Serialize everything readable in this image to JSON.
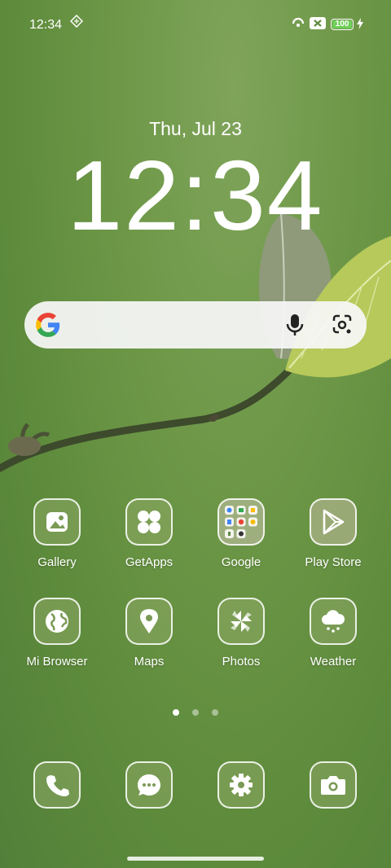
{
  "status_bar": {
    "time": "12:34",
    "battery": "100",
    "icons": [
      "vpn-diamond-icon",
      "hotspot-icon",
      "sim-x-icon",
      "charging-bolt-icon"
    ]
  },
  "clock": {
    "date": "Thu, Jul 23",
    "time": "12:34"
  },
  "search": {
    "icons": [
      "google-g-icon",
      "mic-icon",
      "lens-icon"
    ]
  },
  "apps": [
    {
      "label": "Gallery",
      "icon": "gallery-icon"
    },
    {
      "label": "GetApps",
      "icon": "getapps-icon"
    },
    {
      "label": "Google",
      "icon": "google-folder-icon"
    },
    {
      "label": "Play Store",
      "icon": "play-store-icon"
    },
    {
      "label": "Mi Browser",
      "icon": "globe-icon"
    },
    {
      "label": "Maps",
      "icon": "maps-pin-icon"
    },
    {
      "label": "Photos",
      "icon": "pinwheel-icon"
    },
    {
      "label": "Weather",
      "icon": "cloud-snow-icon"
    }
  ],
  "dock": [
    {
      "icon": "phone-icon"
    },
    {
      "icon": "messages-icon"
    },
    {
      "icon": "settings-icon"
    },
    {
      "icon": "camera-icon"
    }
  ],
  "pager": {
    "pages": 3,
    "active": 1
  },
  "colors": {
    "wallpaper": "#6e9848",
    "search_bg": "#f7f7f7",
    "battery_fill": "#6fcf5a"
  }
}
